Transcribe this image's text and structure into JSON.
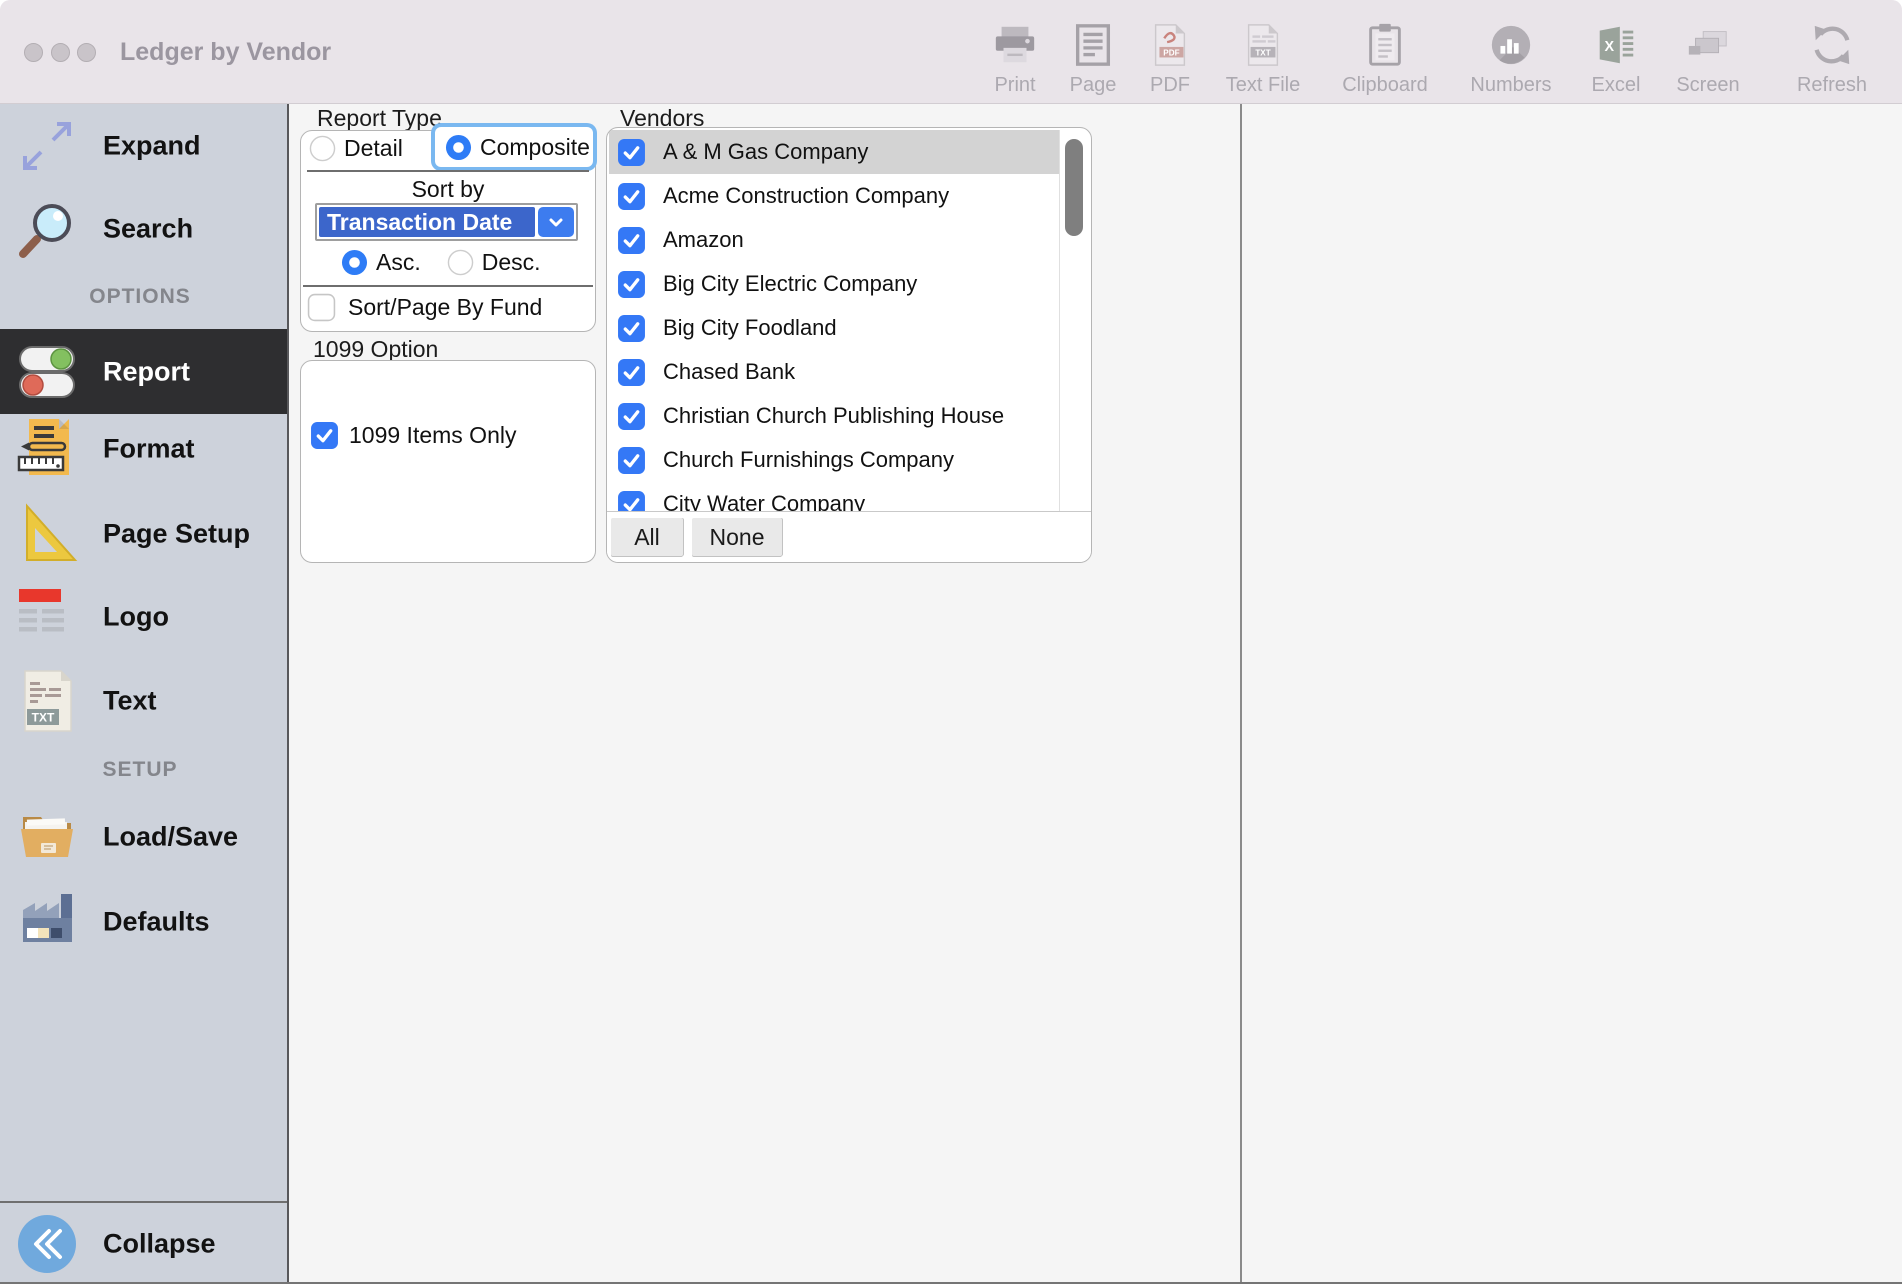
{
  "window": {
    "title": "Ledger by Vendor"
  },
  "toolbar": {
    "items": [
      {
        "label": "Print",
        "icon": "printer-icon",
        "disabled": true
      },
      {
        "label": "Page",
        "icon": "page-icon",
        "disabled": true
      },
      {
        "label": "PDF",
        "icon": "pdf-file-icon",
        "disabled": true
      },
      {
        "label": "Text File",
        "icon": "txt-file-icon",
        "disabled": true
      },
      {
        "label": "Clipboard",
        "icon": "clipboard-icon",
        "disabled": true
      },
      {
        "label": "Numbers",
        "icon": "numbers-chart-icon",
        "disabled": true
      },
      {
        "label": "Excel",
        "icon": "excel-icon",
        "disabled": true
      },
      {
        "label": "Screen",
        "icon": "screen-icon",
        "disabled": true
      },
      {
        "label": "Refresh",
        "icon": "refresh-icon",
        "disabled": true
      }
    ]
  },
  "sidebar": {
    "rows": [
      {
        "type": "item",
        "label": "Expand",
        "icon": "expand-icon"
      },
      {
        "type": "item",
        "label": "Search",
        "icon": "search-icon"
      },
      {
        "type": "header",
        "label": "OPTIONS"
      },
      {
        "type": "item",
        "label": "Report",
        "icon": "report-toggles-icon",
        "selected": true
      },
      {
        "type": "item",
        "label": "Format",
        "icon": "format-icon"
      },
      {
        "type": "item",
        "label": "Page Setup",
        "icon": "page-setup-icon"
      },
      {
        "type": "item",
        "label": "Logo",
        "icon": "logo-icon"
      },
      {
        "type": "item",
        "label": "Text",
        "icon": "text-doc-icon"
      },
      {
        "type": "header",
        "label": "SETUP"
      },
      {
        "type": "item",
        "label": "Load/Save",
        "icon": "folder-icon"
      },
      {
        "type": "item",
        "label": "Defaults",
        "icon": "factory-icon"
      }
    ],
    "collapse": {
      "label": "Collapse",
      "icon": "collapse-icon"
    }
  },
  "report_type": {
    "label": "Report Type",
    "options": [
      "Detail",
      "Composite"
    ],
    "selected": "Composite",
    "sort_by_label": "Sort by",
    "sort_value": "Transaction Date",
    "asc_label": "Asc.",
    "desc_label": "Desc.",
    "sort_direction": "Asc.",
    "sort_page_by_fund_label": "Sort/Page By Fund",
    "sort_page_by_fund_checked": false
  },
  "options_1099": {
    "label": "1099 Option",
    "checkbox_label": "1099 Items Only",
    "checked": true
  },
  "vendors": {
    "label": "Vendors",
    "selected": "A & M Gas Company",
    "all_label": "All",
    "none_label": "None",
    "items": [
      {
        "name": "A & M Gas Company",
        "checked": true
      },
      {
        "name": "Acme Construction Company",
        "checked": true
      },
      {
        "name": "Amazon",
        "checked": true
      },
      {
        "name": "Big City Electric Company",
        "checked": true
      },
      {
        "name": "Big City Foodland",
        "checked": true
      },
      {
        "name": "Chased Bank",
        "checked": true
      },
      {
        "name": "Christian Church Publishing House",
        "checked": true
      },
      {
        "name": "Church Furnishings Company",
        "checked": true
      },
      {
        "name": "City Water Company",
        "checked": true
      }
    ]
  },
  "colors": {
    "titlebar_bg": "#E9E4E9",
    "sidebar_bg": "#CDD2DB",
    "selected_item_bg": "#2E2E30",
    "content_bg": "#F5F5F5",
    "checkbox_blue": "#3478F6",
    "radio_blue": "#2E7CF6",
    "dropdown_selected_bg": "#3C66CB",
    "dropdown_button_bg": "#3D7CEF",
    "focus_ring": "#7AB8F0",
    "row_highlight": "#D3D3D3"
  }
}
